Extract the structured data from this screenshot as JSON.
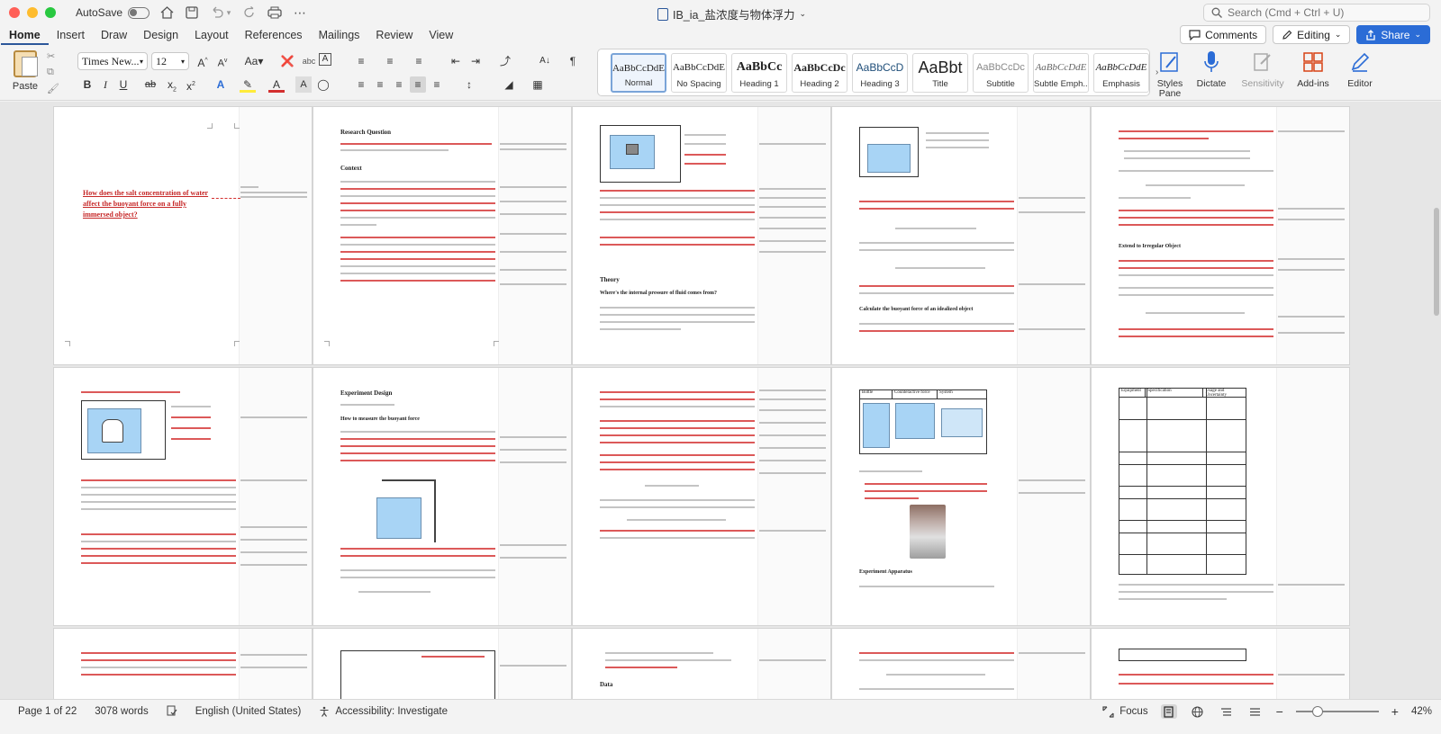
{
  "titlebar": {
    "autosave_label": "AutoSave",
    "doc_title": "IB_ia_盐浓度与物体浮力",
    "search_placeholder": "Search (Cmd + Ctrl + U)"
  },
  "tabs": [
    {
      "label": "Home",
      "active": true
    },
    {
      "label": "Insert"
    },
    {
      "label": "Draw"
    },
    {
      "label": "Design"
    },
    {
      "label": "Layout"
    },
    {
      "label": "References"
    },
    {
      "label": "Mailings"
    },
    {
      "label": "Review"
    },
    {
      "label": "View"
    }
  ],
  "header_buttons": {
    "comments": "Comments",
    "editing": "Editing",
    "share": "Share"
  },
  "ribbon": {
    "paste_label": "Paste",
    "font_name": "Times New...",
    "font_size": "12",
    "styles": [
      {
        "sample": "AaBbCcDdE",
        "name": "Normal",
        "selected": true
      },
      {
        "sample": "AaBbCcDdE",
        "name": "No Spacing"
      },
      {
        "sample": "AaBbCc",
        "name": "Heading 1"
      },
      {
        "sample": "AaBbCcDc",
        "name": "Heading 2"
      },
      {
        "sample": "AaBbCcD",
        "name": "Heading 3"
      },
      {
        "sample": "AaBbt",
        "name": "Title"
      },
      {
        "sample": "AaBbCcDc",
        "name": "Subtitle"
      },
      {
        "sample": "AaBbCcDdE",
        "name": "Subtle Emph..."
      },
      {
        "sample": "AaBbCcDdE",
        "name": "Emphasis"
      }
    ],
    "tools": {
      "styles_pane": "Styles Pane",
      "dictate": "Dictate",
      "sensitivity": "Sensitivity",
      "add_ins": "Add-ins",
      "editor": "Editor"
    }
  },
  "document": {
    "title_question": "How does the salt concentration of water affect the buoyant force on a fully immersed object?",
    "headings": {
      "research_question": "Research Question",
      "context": "Context",
      "theory": "Theory",
      "where_force": "Where's the internal pressure of fluid comes from?",
      "calc_force": "Calculate the buoyant force of an idealized object",
      "extend": "Extend to Irregular Object",
      "experiment_design": "Experiment Design",
      "measure": "How to measure the buoyant force",
      "apparatus": "Experiment Apparatus",
      "data": "Data"
    },
    "apparatus_table": {
      "headers": [
        "Equipment",
        "Specification",
        "Usage and Uncertainty"
      ]
    },
    "setup_table": {
      "headers": [
        "Bottle",
        "Counteractive force",
        "System"
      ]
    }
  },
  "statusbar": {
    "page": "Page 1 of 22",
    "words": "3078 words",
    "language": "English (United States)",
    "accessibility": "Accessibility: Investigate",
    "focus": "Focus",
    "zoom": "42%"
  }
}
